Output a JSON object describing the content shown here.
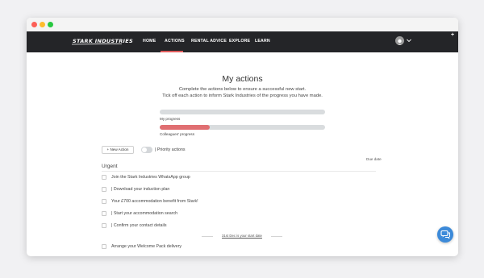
{
  "brand": {
    "logo_text": "STARK INDUSTRIES"
  },
  "nav": {
    "items": [
      {
        "label": "HOME"
      },
      {
        "label": "ACTIONS"
      },
      {
        "label": "RENTAL ADVICE"
      },
      {
        "label": "EXPLORE"
      },
      {
        "label": "LEARN"
      }
    ],
    "active": "ACTIONS"
  },
  "page": {
    "title": "My actions",
    "subtitle_line1": "Complete the actions below to ensure a successful new start.",
    "subtitle_line2": "Tick off each action to inform Stark Industries of the progress you have made."
  },
  "progress": {
    "my_label": "My progress",
    "my_value": 0,
    "colleagues_label": "Colleagues' progress",
    "colleagues_value": 0.3
  },
  "toolbar": {
    "new_action_label": "+ New Action",
    "priority_toggle_label": "| Priority actions",
    "priority_on": false
  },
  "list": {
    "due_header": "Due date",
    "section": "Urgent",
    "tasks": [
      {
        "text": "Join the Stark Industries WhatsApp group"
      },
      {
        "text": "| Download your induction plan"
      },
      {
        "text": "Your £700 accommodation benefit from Stark!"
      },
      {
        "text": "| Start your accommodation search"
      },
      {
        "text": "| Confirm your contact details"
      }
    ],
    "divider_label": "31st Dec is your start date",
    "after_divider": [
      {
        "text": "Arrange your Welcome Pack delivery"
      }
    ]
  },
  "colors": {
    "navbar": "#242528",
    "accent": "#e05c5c",
    "progress_fill": "#e06f72",
    "chat": "#3c8ad9",
    "dot_red": "#fc5f57",
    "dot_yellow": "#febc2e",
    "dot_green": "#28c840"
  },
  "icons": {
    "avatar": "user-avatar-icon",
    "dropdown": "chevron-down-icon",
    "chat": "chat-bubbles-icon",
    "corner": "plus-icon"
  }
}
